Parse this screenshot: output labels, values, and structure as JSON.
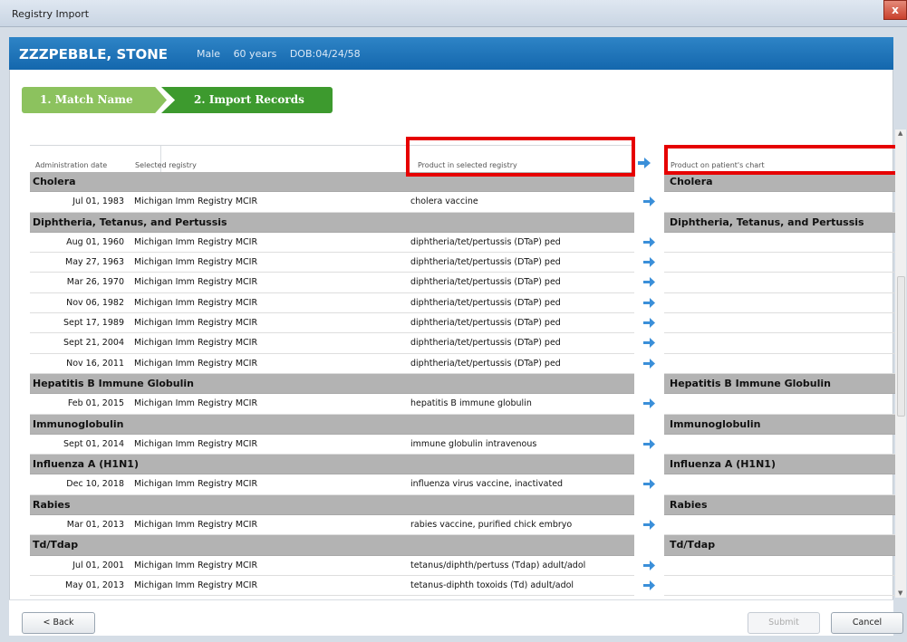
{
  "window": {
    "title": "Registry Import",
    "close_label": "x"
  },
  "patient": {
    "name": "ZZZPEBBLE, STONE",
    "sex": "Male",
    "age": "60 years",
    "dob": "DOB:04/24/58"
  },
  "steps": [
    {
      "label": "1. Match Name"
    },
    {
      "label": "2. Import Records"
    }
  ],
  "table": {
    "headers": {
      "administration_date": "Administration date",
      "selected_registry": "Selected registry",
      "product_in_registry": "Product in selected registry",
      "product_on_chart": "Product on patient's chart"
    },
    "groups": [
      {
        "name": "Cholera",
        "rows": [
          {
            "date": "Jul 01, 1983",
            "registry": "Michigan Imm Registry MCIR",
            "product": "cholera vaccine"
          }
        ]
      },
      {
        "name": "Diphtheria, Tetanus, and Pertussis",
        "rows": [
          {
            "date": "Aug 01, 1960",
            "registry": "Michigan Imm Registry MCIR",
            "product": "diphtheria/tet/pertussis (DTaP) ped"
          },
          {
            "date": "May 27, 1963",
            "registry": "Michigan Imm Registry MCIR",
            "product": "diphtheria/tet/pertussis (DTaP) ped"
          },
          {
            "date": "Mar 26, 1970",
            "registry": "Michigan Imm Registry MCIR",
            "product": "diphtheria/tet/pertussis (DTaP) ped"
          },
          {
            "date": "Nov 06, 1982",
            "registry": "Michigan Imm Registry MCIR",
            "product": "diphtheria/tet/pertussis (DTaP) ped"
          },
          {
            "date": "Sept 17, 1989",
            "registry": "Michigan Imm Registry MCIR",
            "product": "diphtheria/tet/pertussis (DTaP) ped"
          },
          {
            "date": "Sept 21, 2004",
            "registry": "Michigan Imm Registry MCIR",
            "product": "diphtheria/tet/pertussis (DTaP) ped"
          },
          {
            "date": "Nov 16, 2011",
            "registry": "Michigan Imm Registry MCIR",
            "product": "diphtheria/tet/pertussis (DTaP) ped"
          }
        ]
      },
      {
        "name": "Hepatitis B Immune Globulin",
        "rows": [
          {
            "date": "Feb 01, 2015",
            "registry": "Michigan Imm Registry MCIR",
            "product": "hepatitis B immune globulin"
          }
        ]
      },
      {
        "name": "Immunoglobulin",
        "rows": [
          {
            "date": "Sept 01, 2014",
            "registry": "Michigan Imm Registry MCIR",
            "product": "immune globulin intravenous"
          }
        ]
      },
      {
        "name": "Influenza A (H1N1)",
        "rows": [
          {
            "date": "Dec 10, 2018",
            "registry": "Michigan Imm Registry MCIR",
            "product": "influenza virus vaccine, inactivated"
          }
        ]
      },
      {
        "name": "Rabies",
        "rows": [
          {
            "date": "Mar 01, 2013",
            "registry": "Michigan Imm Registry MCIR",
            "product": "rabies vaccine, purified chick embryo"
          }
        ]
      },
      {
        "name": "Td/Tdap",
        "rows": [
          {
            "date": "Jul 01, 2001",
            "registry": "Michigan Imm Registry MCIR",
            "product": "tetanus/diphth/pertuss (Tdap) adult/adol"
          },
          {
            "date": "May 01, 2013",
            "registry": "Michigan Imm Registry MCIR",
            "product": "tetanus-diphth toxoids (Td) adult/adol"
          }
        ]
      }
    ]
  },
  "buttons": {
    "back": "< Back",
    "submit": "Submit",
    "cancel": "Cancel"
  },
  "colors": {
    "header_blue": "#1b6fb5",
    "step_active": "#3d9a2e",
    "step_done": "#8cc25e",
    "highlight_red": "#e60000",
    "arrow_blue": "#3a8fd9"
  }
}
